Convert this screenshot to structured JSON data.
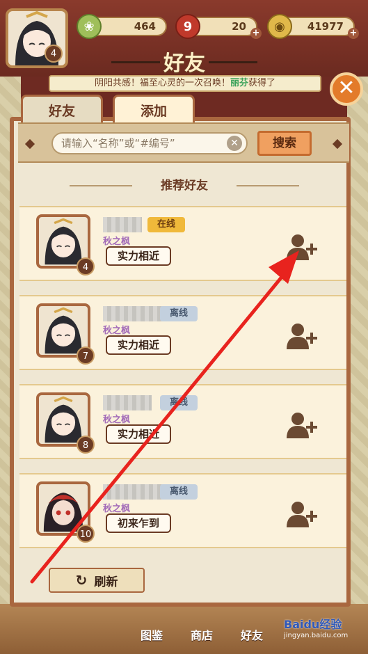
{
  "top_bar": {
    "player_level": "4",
    "jade": "464",
    "stamina": "20",
    "coins": "41977"
  },
  "title": "好友",
  "marquee": {
    "text_before": "阴阳共感！福至心灵的一次召唤！",
    "highlight": "丽芬",
    "text_after": "获得了"
  },
  "tabs": {
    "friends": "好友",
    "add": "添加"
  },
  "search": {
    "placeholder": "请输入“名称”或“#编号”",
    "button": "搜索"
  },
  "section_title": "推荐好友",
  "friends": [
    {
      "level": "4",
      "status": "在线",
      "online": true,
      "sub": "秋之枫",
      "tag": "实力相近"
    },
    {
      "level": "7",
      "status": "离线",
      "online": false,
      "sub": "秋之枫",
      "tag": "实力相近"
    },
    {
      "level": "8",
      "status": "离线",
      "online": false,
      "sub": "秋之枫",
      "tag": "实力相近"
    },
    {
      "level": "10",
      "status": "离线",
      "online": false,
      "sub": "秋之枫",
      "tag": "初来乍到"
    }
  ],
  "refresh": "刷新",
  "bottom_nav": [
    "图鉴",
    "商店",
    "好友"
  ],
  "watermark": {
    "logo": "Baidu经验",
    "url": "jingyan.baidu.com"
  },
  "colors": {
    "panel_border": "#a9673f",
    "online": "#f0b93a",
    "offline": "#c3d0de",
    "arrow": "#e8231e"
  }
}
